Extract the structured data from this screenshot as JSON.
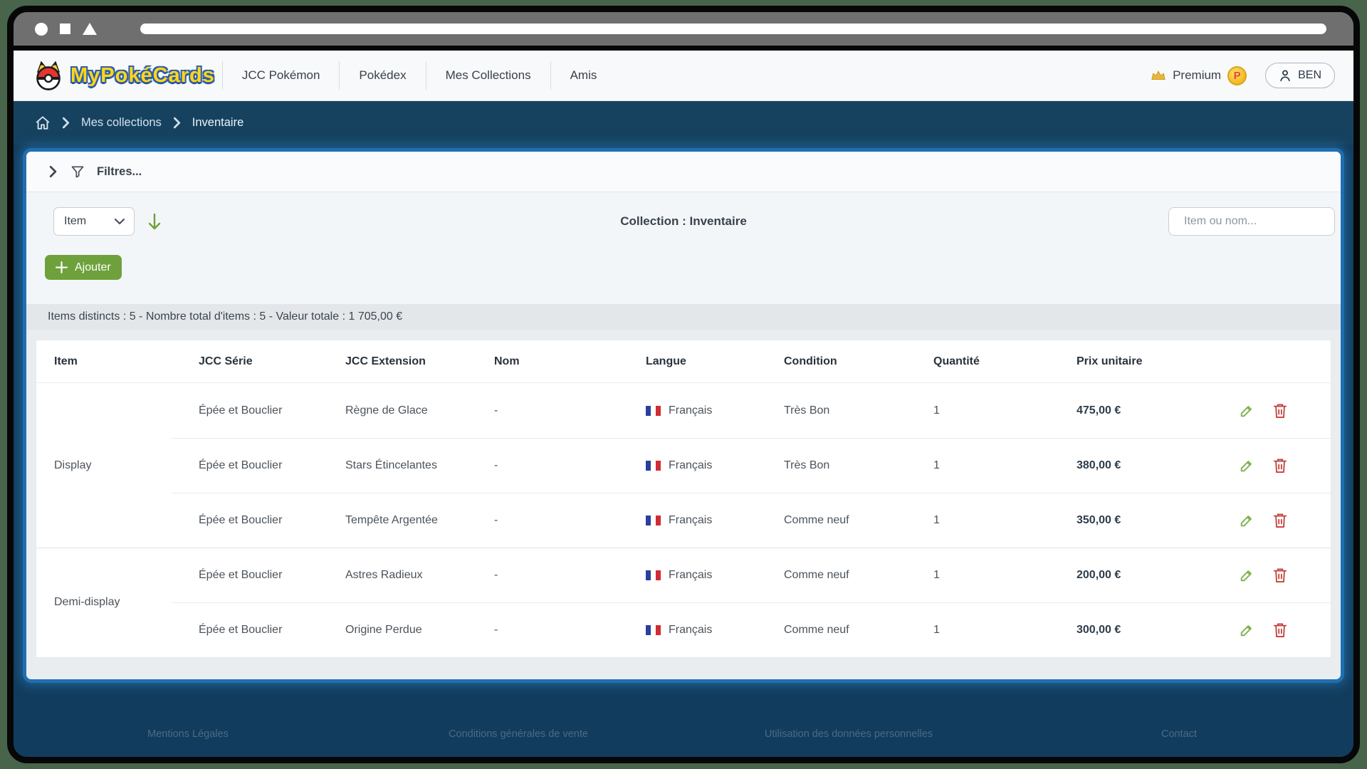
{
  "browser": {
    "url_value": ""
  },
  "header": {
    "logo_text": "MyPokéCards",
    "nav_items": [
      "JCC Pokémon",
      "Pokédex",
      "Mes Collections",
      "Amis"
    ],
    "premium_label": "Premium",
    "coin_letter": "P",
    "user_label": "BEN"
  },
  "breadcrumb": {
    "items": [
      "Mes collections",
      "Inventaire"
    ]
  },
  "filters": {
    "label": "Filtres..."
  },
  "toolbar": {
    "type_select_value": "Item",
    "collection_title": "Collection : Inventaire",
    "search_placeholder": "Item ou nom...",
    "add_button_label": "Ajouter"
  },
  "summary": {
    "text": "Items distincts : 5 - Nombre total d'items : 5 - Valeur totale : 1 705,00 €"
  },
  "table": {
    "columns": [
      "Item",
      "JCC Série",
      "JCC Extension",
      "Nom",
      "Langue",
      "Condition",
      "Quantité",
      "Prix unitaire"
    ],
    "groups": [
      {
        "label": "Display"
      },
      {
        "label": "Demi-display"
      }
    ],
    "rows": [
      {
        "serie": "Épée et Bouclier",
        "extension": "Règne de Glace",
        "nom": "-",
        "langue": "Français",
        "condition": "Très Bon",
        "quantite": "1",
        "prix": "475,00 €"
      },
      {
        "serie": "Épée et Bouclier",
        "extension": "Stars Étincelantes",
        "nom": "-",
        "langue": "Français",
        "condition": "Très Bon",
        "quantite": "1",
        "prix": "380,00 €"
      },
      {
        "serie": "Épée et Bouclier",
        "extension": "Tempête Argentée",
        "nom": "-",
        "langue": "Français",
        "condition": "Comme neuf",
        "quantite": "1",
        "prix": "350,00 €"
      },
      {
        "serie": "Épée et Bouclier",
        "extension": "Astres Radieux",
        "nom": "-",
        "langue": "Français",
        "condition": "Comme neuf",
        "quantite": "1",
        "prix": "200,00 €"
      },
      {
        "serie": "Épée et Bouclier",
        "extension": "Origine Perdue",
        "nom": "-",
        "langue": "Français",
        "condition": "Comme neuf",
        "quantite": "1",
        "prix": "300,00 €"
      }
    ]
  },
  "footer": {
    "links": [
      "Mentions Légales",
      "Conditions générales de vente",
      "Utilisation des données personnelles",
      "Contact"
    ]
  },
  "colors": {
    "accent_green": "#6ea13c",
    "navy": "#123c5d",
    "panel_border_blue": "#1e6fb2",
    "flag_blue": "#2a3f9d",
    "flag_red": "#d02c35",
    "coin_gold": "#f3b91f",
    "logo_yellow": "#ffd61c"
  }
}
